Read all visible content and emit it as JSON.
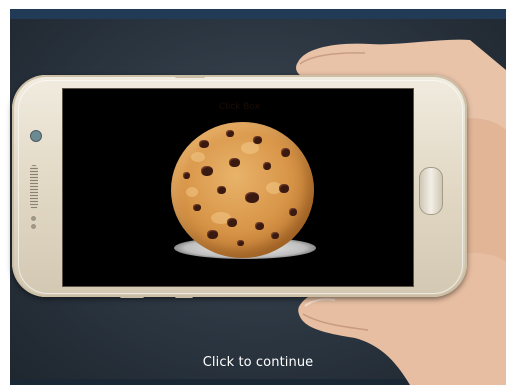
{
  "screen": {
    "cookie_label": "Click Box",
    "continue_label": "Click to continue"
  },
  "colors": {
    "background": "#2b3540",
    "phone_body": "#e3dac7",
    "screen": "#000000",
    "cookie": "#d9974a",
    "text": "#ffffff"
  }
}
